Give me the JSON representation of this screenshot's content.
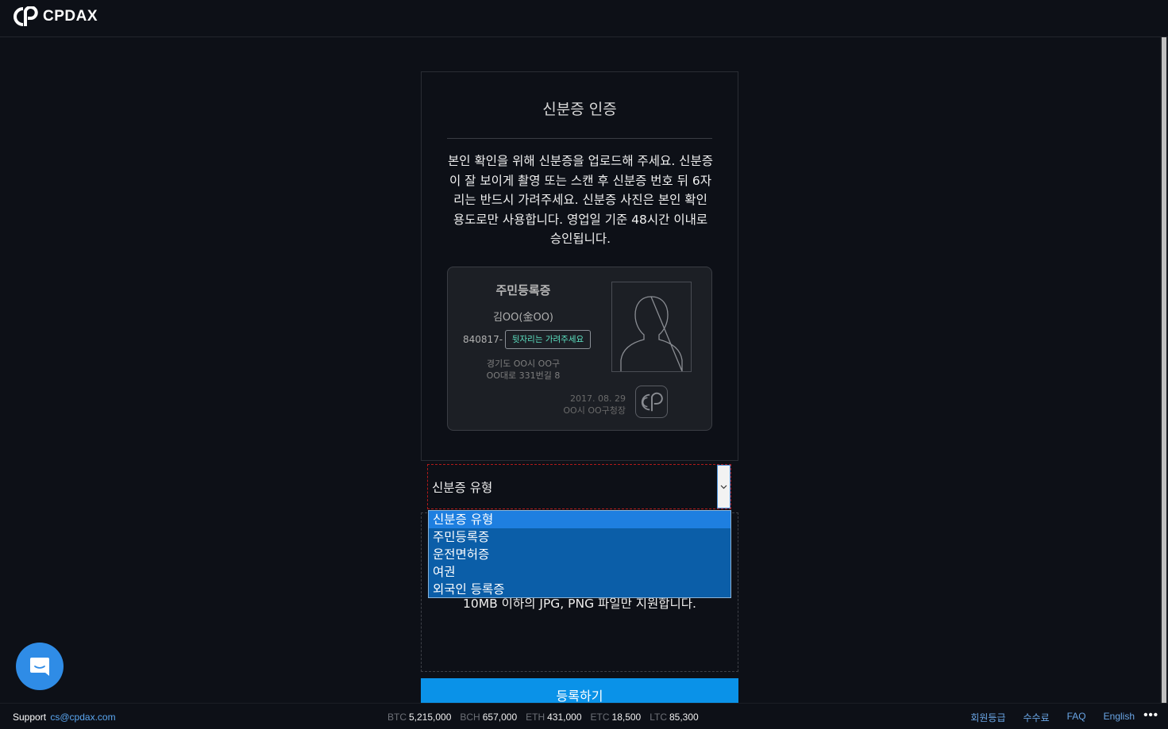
{
  "header": {
    "brand": "CPDAX"
  },
  "card": {
    "title": "신분증 인증",
    "instructions": "본인 확인을 위해 신분증을 업로드해 주세요. 신분증이 잘 보이게 촬영 또는 스캔 후 신분증 번호 뒤 6자리는 반드시 가려주세요. 신분증 사진은 본인 확인 용도로만 사용합니다. 영업일 기준 48시간 이내로 승인됩니다."
  },
  "id_sample": {
    "type": "주민등록증",
    "name": "김OO(金OO)",
    "number": "840817-",
    "hide_label": "뒷자리는 가려주세요",
    "address_line1": "경기도 OO시 OO구",
    "address_line2": "OO대로 331번길 8",
    "issue_date": "2017. 08. 29",
    "issuer": "OO시 OO구청장"
  },
  "id_select": {
    "value": "신분증 유형",
    "options": [
      "신분증 유형",
      "주민등록증",
      "운전면허증",
      "여권",
      "외국인 등록증"
    ],
    "selected_index": 0
  },
  "dropzone": {
    "text": "10MB 이하의 JPG, PNG 파일만 지원합니다."
  },
  "submit_label": "등록하기",
  "footer": {
    "support_label": "Support",
    "support_email": "cs@cpdax.com",
    "tickers": [
      {
        "symbol": "BTC",
        "value": "5,215,000"
      },
      {
        "symbol": "BCH",
        "value": "657,000"
      },
      {
        "symbol": "ETH",
        "value": "431,000"
      },
      {
        "symbol": "ETC",
        "value": "18,500"
      },
      {
        "symbol": "LTC",
        "value": "85,300"
      }
    ],
    "links": [
      "회원등급",
      "수수료",
      "FAQ",
      "English"
    ],
    "more": "•••"
  },
  "colors": {
    "accent": "#0a92e8",
    "background": "#0d1017",
    "link": "#6aa6e6",
    "highlight": "#5de2c2"
  },
  "icons": {
    "chat": "chat-bubble-icon",
    "logo": "cpdax-logo-icon",
    "seal": "cpdax-seal-icon",
    "avatar": "person-silhouette-icon",
    "arrow": "chevron-down-icon"
  }
}
